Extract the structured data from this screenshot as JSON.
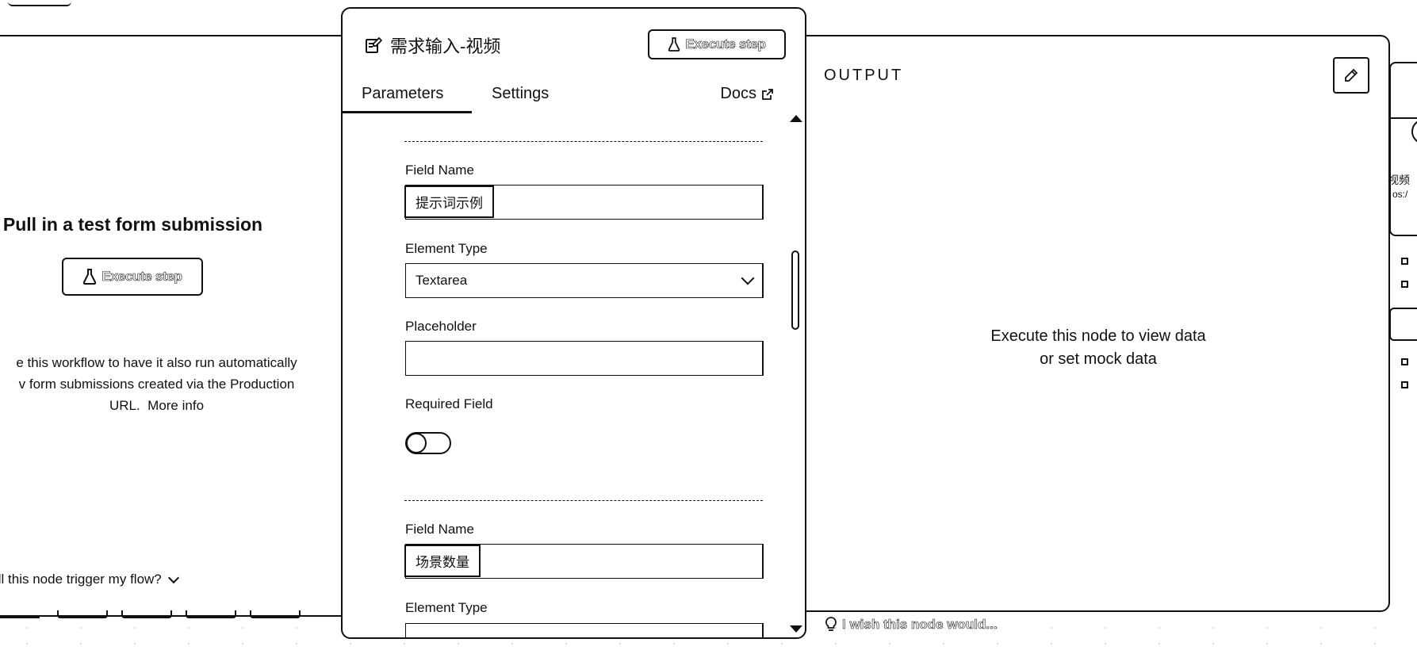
{
  "input_panel": {
    "title": "Pull in a test form submission",
    "execute_label": "Execute step",
    "description_lines": [
      "e this workflow to have it also run automatically",
      "v form submissions created via the Production",
      "URL."
    ],
    "more_info": "More info",
    "trigger_question": "ill this node trigger my flow?"
  },
  "node": {
    "title": "需求输入-视频",
    "execute_label": "Execute step",
    "tabs": [
      {
        "label": "Parameters",
        "active": true
      },
      {
        "label": "Settings",
        "active": false
      }
    ],
    "docs_label": "Docs"
  },
  "form_fields": [
    {
      "field_name_label": "Field Name",
      "field_name_value": "提示词示例",
      "element_type_label": "Element Type",
      "element_type_value": "Textarea",
      "placeholder_label": "Placeholder",
      "placeholder_value": "",
      "required_label": "Required Field",
      "required": false
    },
    {
      "field_name_label": "Field Name",
      "field_name_value": "场景数量",
      "element_type_label": "Element Type"
    }
  ],
  "output": {
    "title": "OUTPUT",
    "empty_line1": "Execute this node to view data",
    "empty_line2": "or set mock data"
  },
  "canvas": {
    "node_text_1": "视频",
    "node_text_2": "os:/",
    "feedback": "I wish this node would..."
  },
  "icons": {
    "flask": "flask-icon",
    "note": "note-edit-icon",
    "external": "external-link-icon",
    "pencil": "pencil-icon",
    "bulb": "lightbulb-icon",
    "chevron": "chevron-down-icon"
  }
}
